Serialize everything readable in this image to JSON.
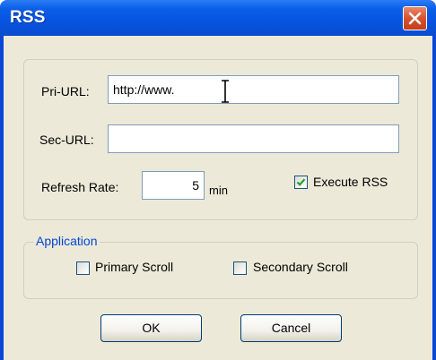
{
  "window": {
    "title": "RSS",
    "close_icon": "close-icon"
  },
  "urls": {
    "primary_label": "Pri-URL:",
    "primary_value": "http://www.",
    "secondary_label": "Sec-URL:",
    "secondary_value": ""
  },
  "refresh": {
    "label": "Refresh Rate:",
    "value": "5",
    "unit": "min"
  },
  "execute": {
    "label": "Execute RSS",
    "checked": true
  },
  "application": {
    "legend": "Application",
    "primary_scroll": {
      "label": "Primary Scroll",
      "checked": false
    },
    "secondary_scroll": {
      "label": "Secondary Scroll",
      "checked": false
    }
  },
  "buttons": {
    "ok": "OK",
    "cancel": "Cancel"
  },
  "colors": {
    "title_bar": "#0a5ee8",
    "close_button": "#d8522e",
    "legend": "#0046d5",
    "dialog_bg": "#ece9d8"
  }
}
